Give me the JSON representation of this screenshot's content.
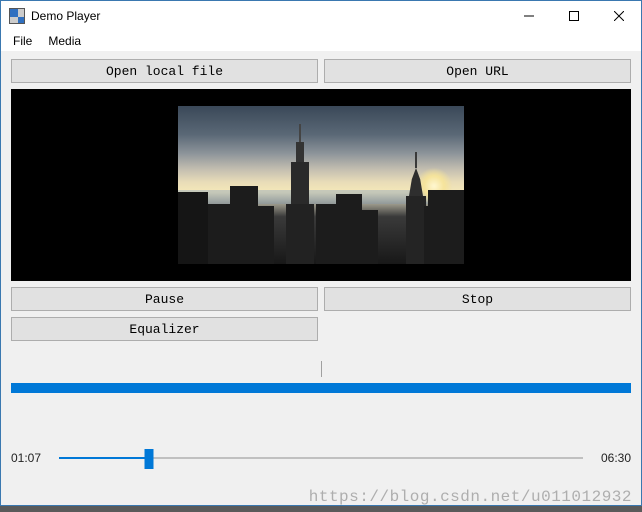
{
  "window": {
    "title": "Demo Player"
  },
  "menu": {
    "file": "File",
    "media": "Media"
  },
  "buttons": {
    "open_local": "Open local file",
    "open_url": "Open URL",
    "pause": "Pause",
    "stop": "Stop",
    "equalizer": "Equalizer"
  },
  "volume": {
    "value_pct": 100
  },
  "playback": {
    "position_label": "01:07",
    "duration_label": "06:30",
    "position_sec": 67,
    "duration_sec": 390
  },
  "watermark": "https://blog.csdn.net/u011012932"
}
